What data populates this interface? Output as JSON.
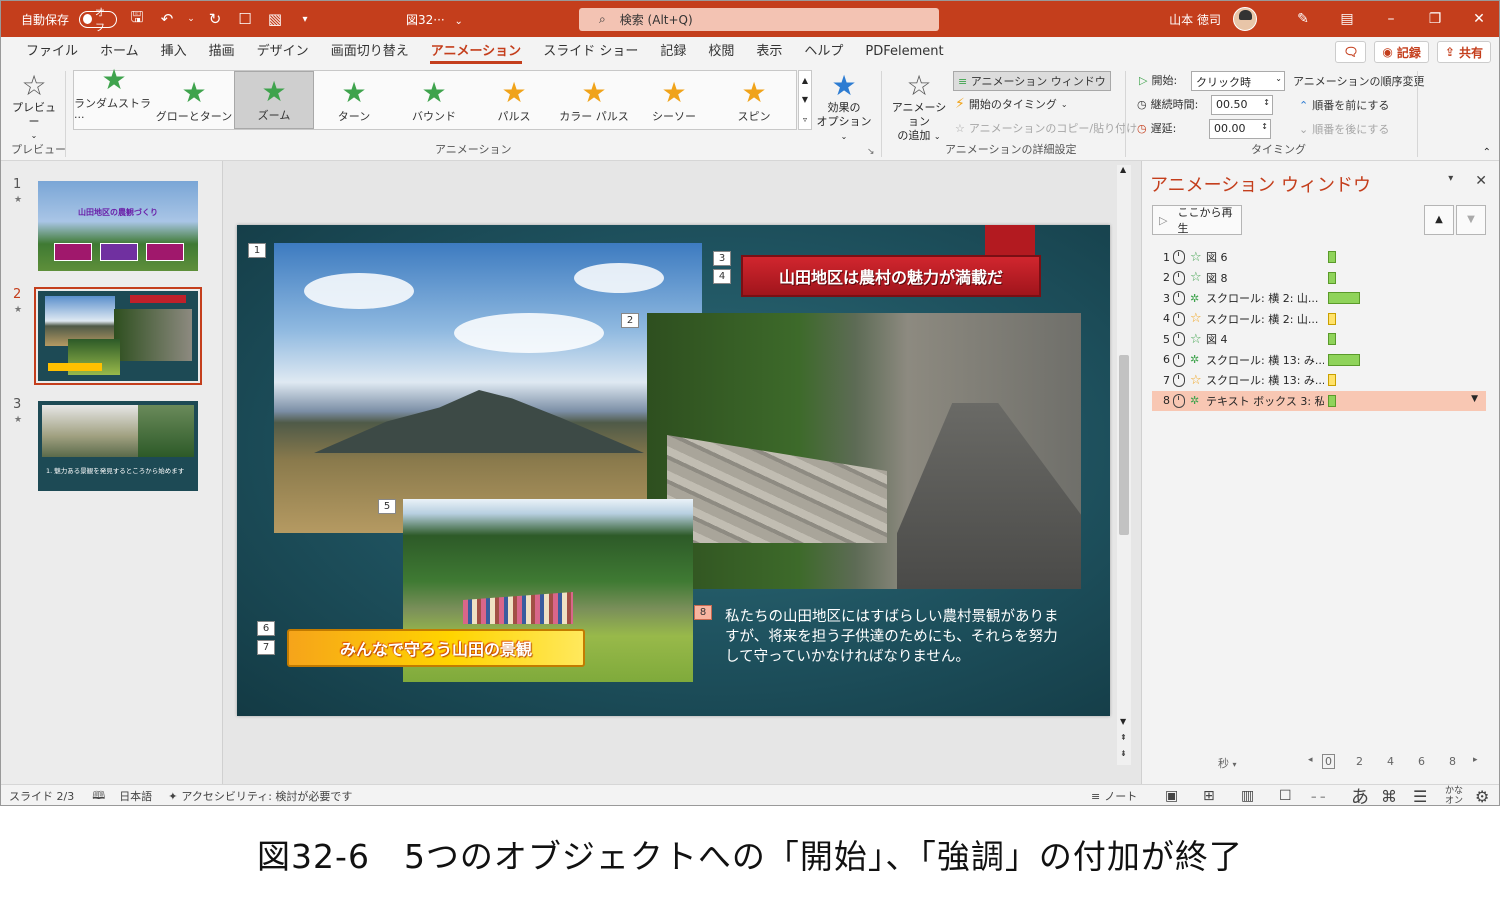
{
  "titlebar": {
    "autosave_label": "自動保存",
    "autosave_state": "オフ",
    "doc_title": "図32···",
    "search_placeholder": "検索 (Alt+Q)",
    "user_name": "山本 徳司"
  },
  "menu": {
    "tabs": [
      "ファイル",
      "ホーム",
      "挿入",
      "描画",
      "デザイン",
      "画面切り替え",
      "アニメーション",
      "スライド ショー",
      "記録",
      "校閲",
      "表示",
      "ヘルプ",
      "PDFelement"
    ],
    "active": "アニメーション",
    "record_label": "記録",
    "share_label": "共有"
  },
  "ribbon": {
    "preview_label": "プレビュー",
    "preview_group": "プレビュー",
    "animation_group": "アニメーション",
    "gallery": [
      {
        "label": "ランダムストラ···",
        "color": "green"
      },
      {
        "label": "グローとターン",
        "color": "green"
      },
      {
        "label": "ズーム",
        "color": "green"
      },
      {
        "label": "ターン",
        "color": "green"
      },
      {
        "label": "バウンド",
        "color": "green"
      },
      {
        "label": "パルス",
        "color": "gold"
      },
      {
        "label": "カラー パルス",
        "color": "gold"
      },
      {
        "label": "シーソー",
        "color": "gold"
      },
      {
        "label": "スピン",
        "color": "gold"
      }
    ],
    "selected_effect": "ズーム",
    "effect_options_label1": "効果の",
    "effect_options_label2": "オプション",
    "add_anim_label1": "アニメーション",
    "add_anim_label2": "の追加",
    "anim_pane_btn": "アニメーション ウィンドウ",
    "trigger_label": "開始のタイミング",
    "copy_anim_label": "アニメーションのコピー/貼り付け",
    "advanced_group": "アニメーションの詳細設定",
    "start_label": "開始:",
    "start_value": "クリック時",
    "duration_label": "継続時間:",
    "duration_value": "00.50",
    "delay_label": "遅延:",
    "delay_value": "00.00",
    "reorder_label": "アニメーションの順序変更",
    "move_earlier": "順番を前にする",
    "move_later": "順番を後にする",
    "timing_group": "タイミング"
  },
  "thumbnails": [
    {
      "num": "1",
      "title": "山田地区の農観づくり"
    },
    {
      "num": "2"
    },
    {
      "num": "3",
      "caption": "1. 魅力ある景観を発見するところから始めます"
    }
  ],
  "slide": {
    "tags": [
      "1",
      "2",
      "3",
      "4",
      "5",
      "6",
      "7",
      "8"
    ],
    "title_banner": "山田地区は農村の魅力が満載だ",
    "bottom_banner": "みんなで守ろう山田の景観",
    "body_text": "私たちの山田地区にはすばらしい農村景観がありますが、将来を担う子供達のためにも、それらを努力して守っていかなければなりません。"
  },
  "anim_pane": {
    "title": "アニメーション ウィンドウ",
    "play_label": "ここから再生",
    "items": [
      {
        "num": "1",
        "label": "図 6",
        "type": "green",
        "bar": "g",
        "bar_pct": 0.06
      },
      {
        "num": "2",
        "label": "図 8",
        "type": "green",
        "bar": "g",
        "bar_pct": 0.06
      },
      {
        "num": "3",
        "label": "スクロール: 横 2: 山...",
        "type": "scroll",
        "bar": "g",
        "bar_pct": 0.22
      },
      {
        "num": "4",
        "label": "スクロール: 横 2: 山...",
        "type": "gold",
        "bar": "y",
        "bar_pct": 0.06
      },
      {
        "num": "5",
        "label": "図 4",
        "type": "green",
        "bar": "g",
        "bar_pct": 0.06
      },
      {
        "num": "6",
        "label": "スクロール: 横 13: み...",
        "type": "scroll",
        "bar": "g",
        "bar_pct": 0.22
      },
      {
        "num": "7",
        "label": "スクロール: 横 13: み...",
        "type": "gold",
        "bar": "y",
        "bar_pct": 0.06
      },
      {
        "num": "8",
        "label": "テキスト ボックス 3: 私...",
        "type": "scroll",
        "bar": "g",
        "bar_pct": 0.06,
        "selected": true
      }
    ],
    "seconds_label": "秒",
    "ticks": [
      "0",
      "2",
      "4",
      "6",
      "8"
    ]
  },
  "status": {
    "slide_pos": "スライド 2/3",
    "language": "日本語",
    "accessibility": "アクセシビリティ: 検討が必要です",
    "notes": "ノート"
  },
  "caption": "図32-6　5つのオブジェクトへの「開始」、「強調」の付加が終了"
}
